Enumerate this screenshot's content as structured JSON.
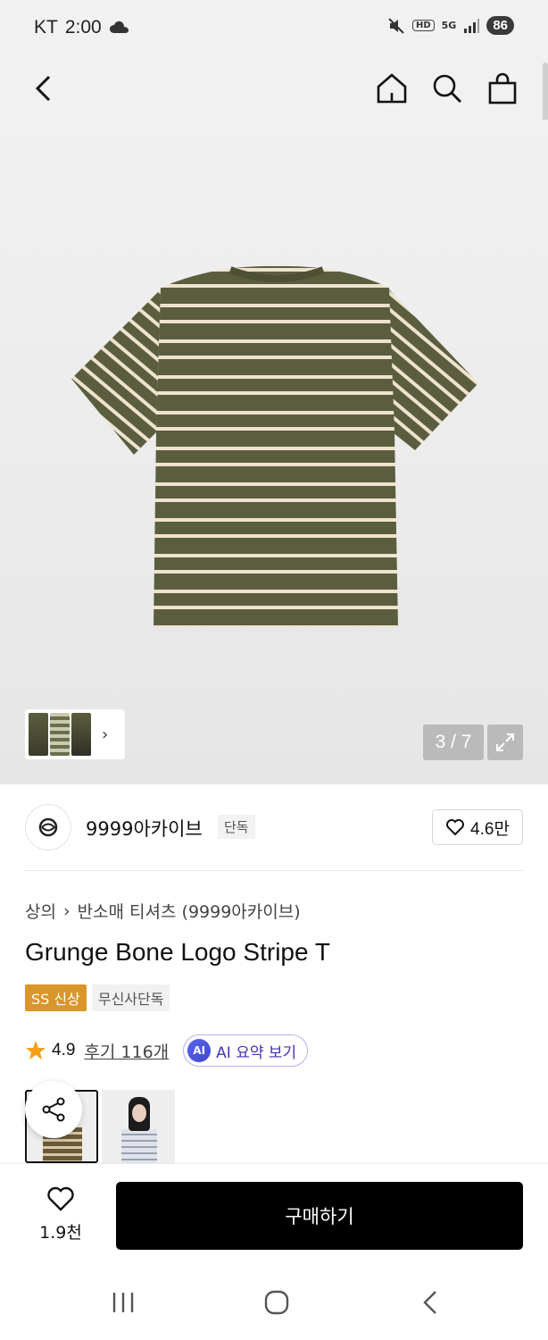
{
  "status_bar": {
    "carrier": "KT",
    "time": "2:00",
    "network_tag": "HD",
    "network_gen": "5G",
    "battery": "86"
  },
  "icons": {
    "back": "back-arrow-icon",
    "home": "home-icon",
    "search": "search-icon",
    "cart": "shopping-bag-icon",
    "expand": "expand-icon",
    "heart": "heart-icon",
    "share": "share-icon",
    "star": "star-icon"
  },
  "gallery": {
    "current": "3 / 7"
  },
  "brand": {
    "name": "9999아카이브",
    "tag": "단독",
    "likes": "4.6만"
  },
  "product": {
    "breadcrumb": [
      "상의",
      "반소매 티셔츠 (9999아카이브)"
    ],
    "title": "Grunge Bone Logo Stripe T",
    "tags": [
      "SS 신상",
      "무신사단독"
    ],
    "rating": "4.9",
    "reviews": "후기 116개",
    "ai_summary": "AI 요약 보기",
    "ai_badge": "AI"
  },
  "bottom": {
    "wish_count": "1.9천",
    "buy_label": "구매하기"
  },
  "colors": {
    "shirt_base": "#5b5e3e",
    "shirt_stripe": "#efe2cf",
    "tag_orange": "#d9962a",
    "ai_purple": "#4333b7"
  }
}
